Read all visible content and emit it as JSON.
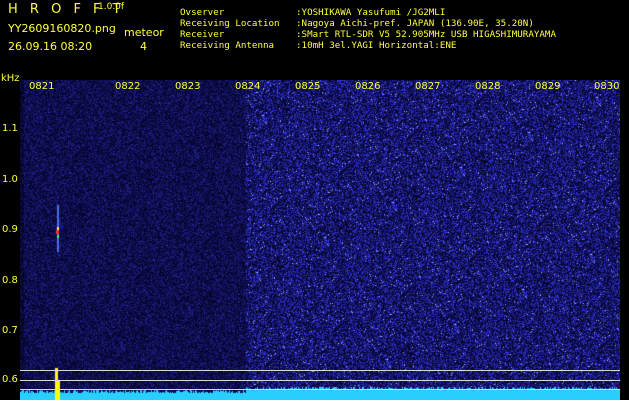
{
  "app": {
    "logo": "H R O F F T",
    "version": "1.0.0f",
    "filename": "YY2609160820.png",
    "datetime": "26.09.16 08:20",
    "event_label": "meteor",
    "event_count": "4"
  },
  "info": {
    "rows": [
      {
        "label": "Ovserver",
        "value": ":YOSHIKAWA Yasufumi /JG2MLI"
      },
      {
        "label": "Receiving Location",
        "value": ":Nagoya Aichi-pref. JAPAN (136.90E, 35.20N)"
      },
      {
        "label": "Receiver",
        "value": ":SMart RTL-SDR V5 52.905MHz USB HIGASHIMURAYAMA"
      },
      {
        "label": "Receiving Antenna",
        "value": ":10mH 3el.YAGI Horizontal:ENE"
      }
    ]
  },
  "axis": {
    "y_unit": "kHz",
    "y_ticks": [
      "1.1",
      "1.0",
      "0.9",
      "0.8",
      "0.7",
      "0.6"
    ],
    "x_ticks": [
      "0821",
      "0822",
      "0823",
      "0824",
      "0825",
      "0826",
      "0827",
      "0828",
      "0829",
      "0830"
    ]
  },
  "colors": {
    "text": "#ffff3a",
    "background": "#000000",
    "noise_low": "#0a0a6e",
    "noise_high": "#1e1ed2",
    "level_trace": "#29d0ff",
    "meteor_peak": "#ffff00"
  }
}
